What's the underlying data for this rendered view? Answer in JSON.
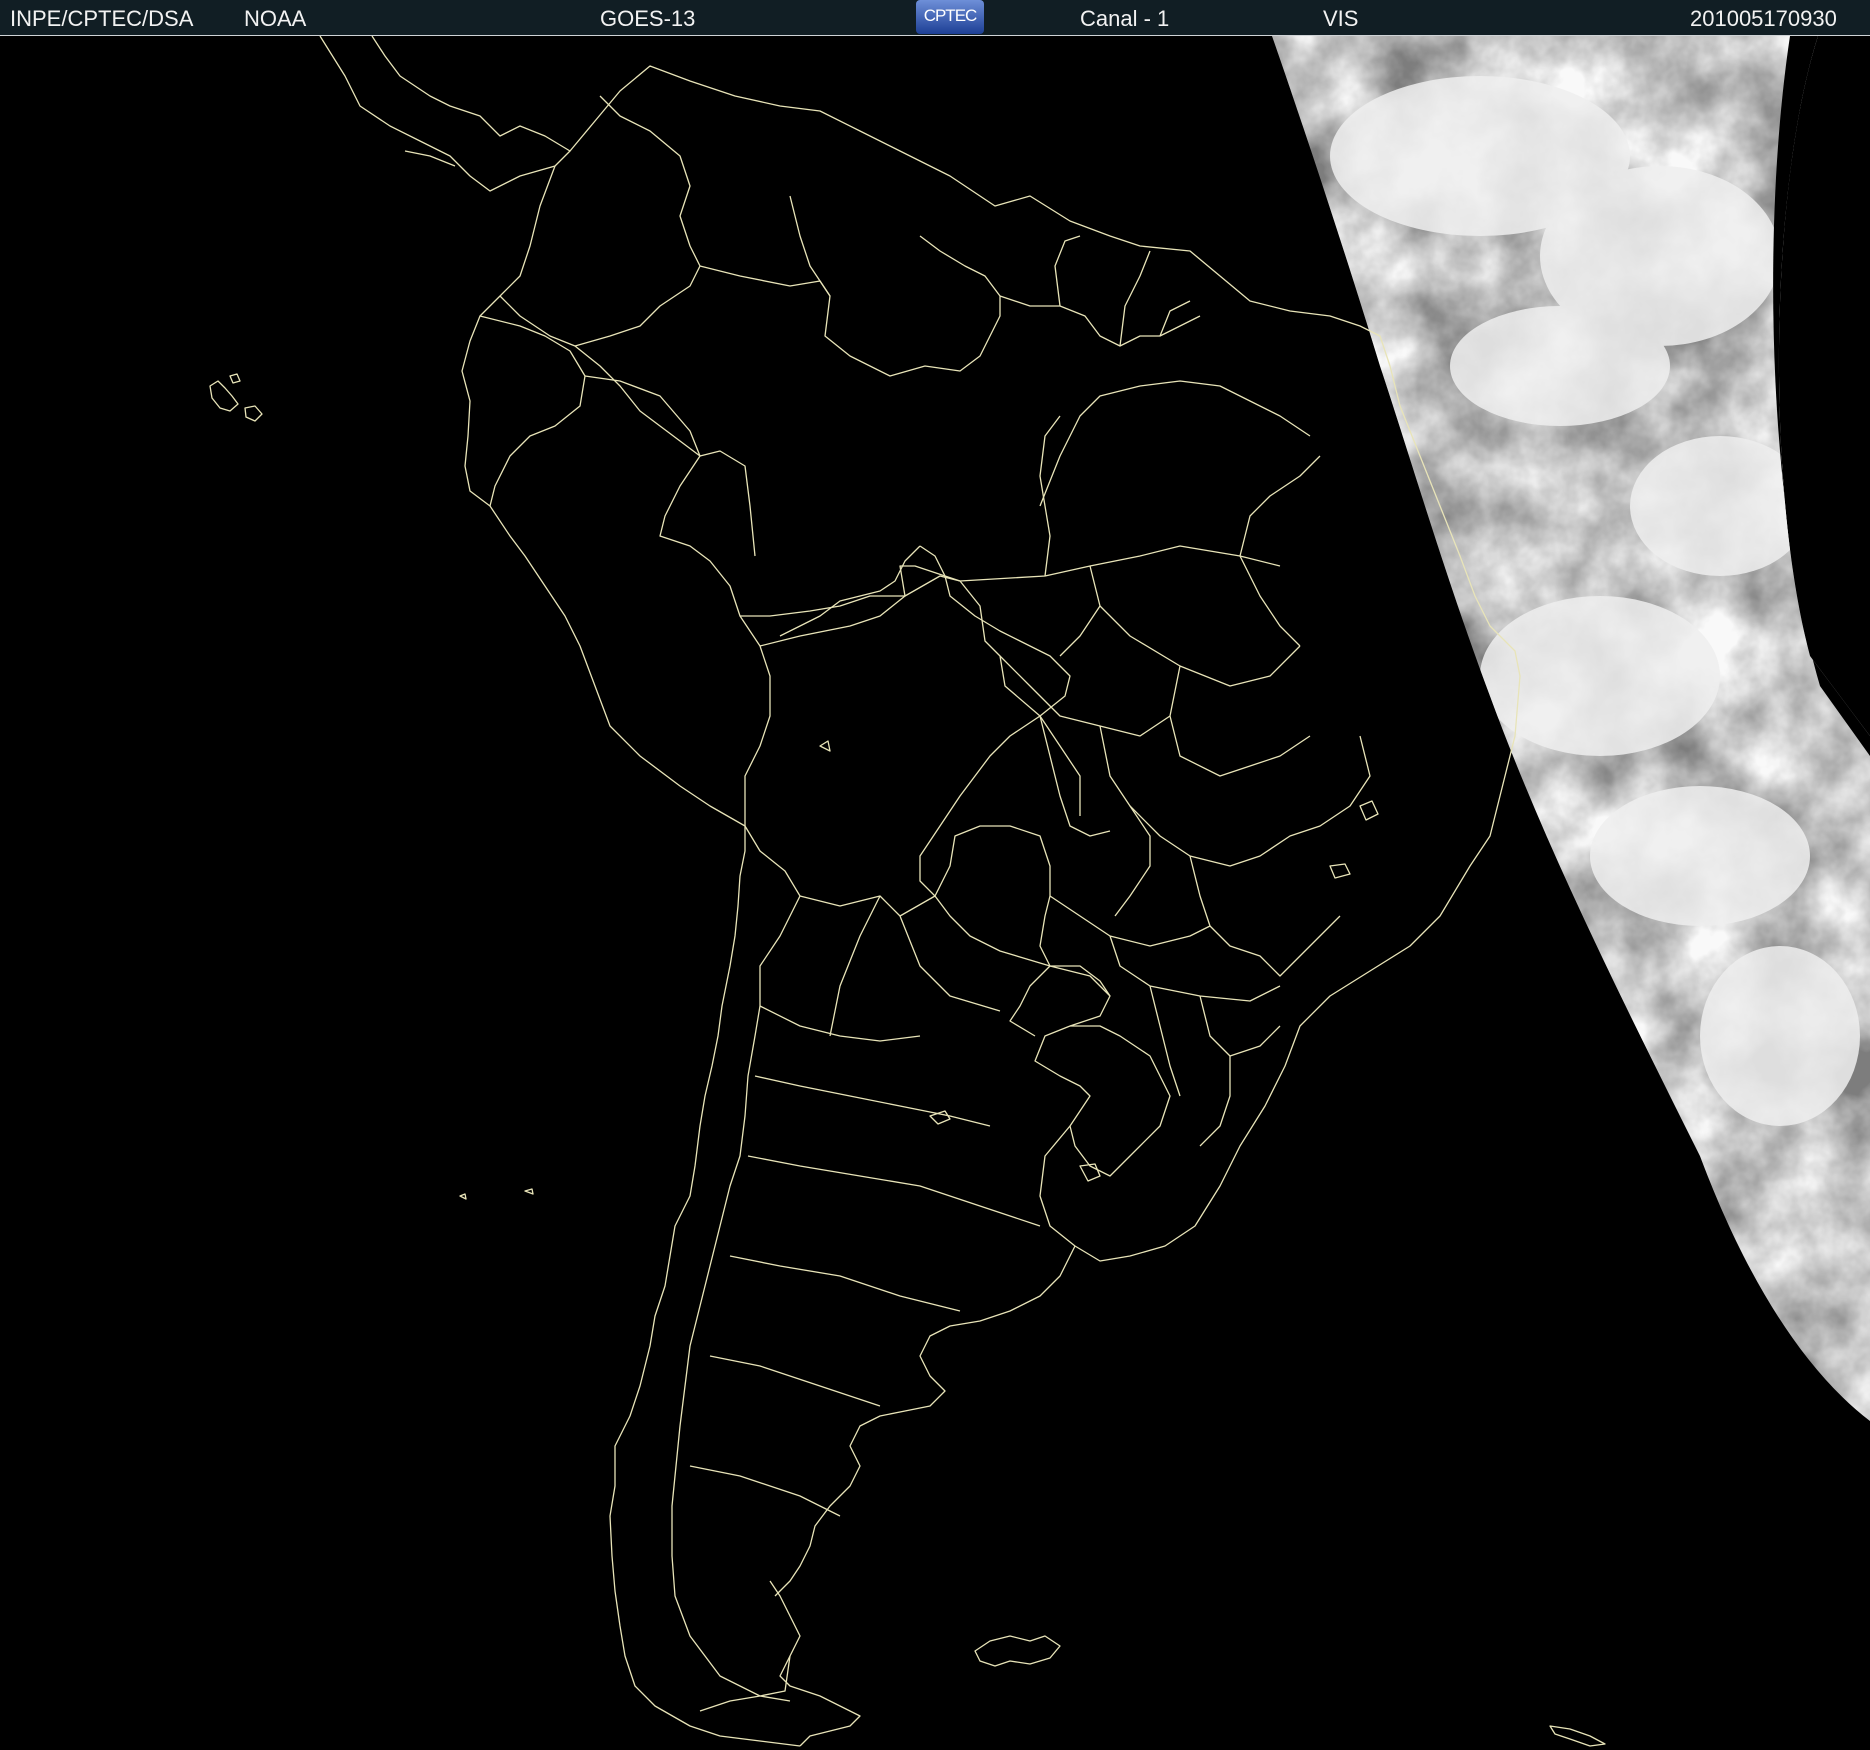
{
  "header": {
    "producer": "INPE/CPTEC/DSA",
    "agency": "NOAA",
    "satellite": "GOES-13",
    "logo_text": "CPTEC",
    "channel": "Canal - 1",
    "band": "VIS",
    "timestamp": "201005170930"
  },
  "colors": {
    "header_bg": "#111e24",
    "header_text": "#f2f2f2",
    "map_bg": "#000000",
    "boundary": "#e8e4b8"
  },
  "map": {
    "region": "South America",
    "layer": "visible satellite imagery",
    "features": [
      "coastlines",
      "country borders",
      "state borders",
      "cloud cover (east)"
    ]
  }
}
